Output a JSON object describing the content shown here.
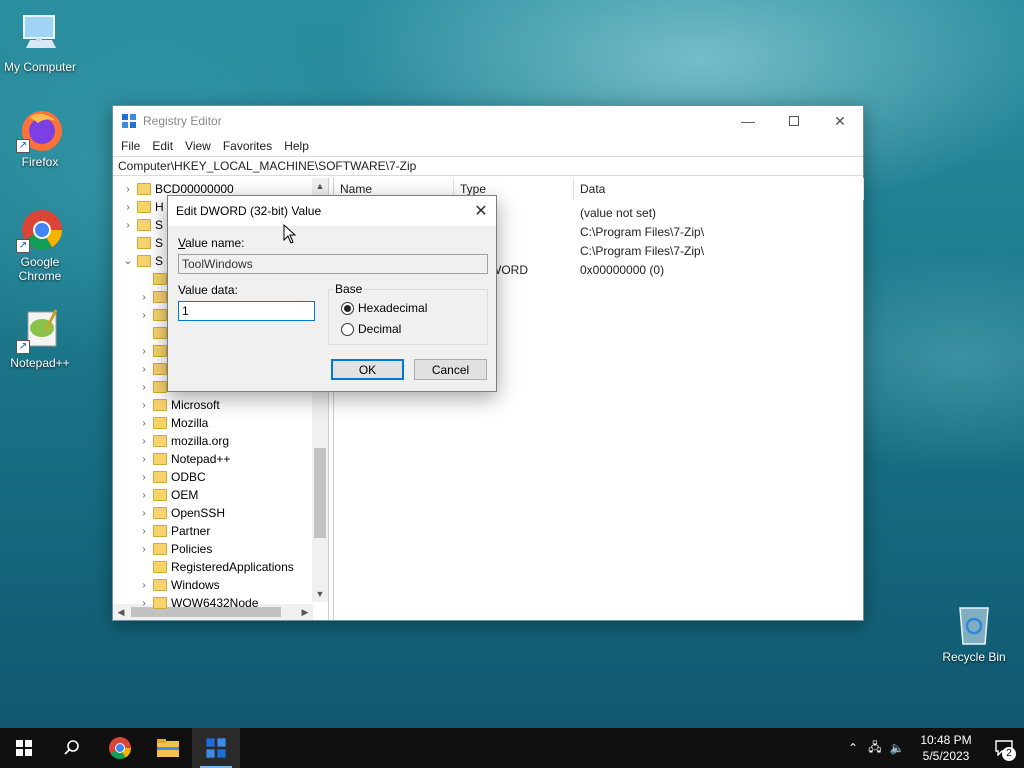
{
  "desktop": {
    "icons": [
      {
        "label": "My Computer",
        "icon": "computer-icon"
      },
      {
        "label": "Firefox",
        "icon": "firefox-icon"
      },
      {
        "label": "Google Chrome",
        "icon": "chrome-icon"
      },
      {
        "label": "Notepad++",
        "icon": "notepadpp-icon"
      },
      {
        "label": "Recycle Bin",
        "icon": "recycle-bin-icon"
      }
    ]
  },
  "regedit": {
    "title": "Registry Editor",
    "menu": [
      "File",
      "Edit",
      "View",
      "Favorites",
      "Help"
    ],
    "address": "Computer\\HKEY_LOCAL_MACHINE\\SOFTWARE\\7-Zip",
    "tree": [
      {
        "label": "BCD00000000",
        "chev": "›"
      },
      {
        "label": "H",
        "chev": "›"
      },
      {
        "label": "S",
        "chev": "›"
      },
      {
        "label": "S",
        "chev": ""
      },
      {
        "label": "S",
        "chev": "⌄"
      },
      {
        "label": "",
        "chev": ""
      },
      {
        "label": "",
        "chev": "›"
      },
      {
        "label": "",
        "chev": "›"
      },
      {
        "label": "",
        "chev": ""
      },
      {
        "label": "",
        "chev": "›"
      },
      {
        "label": "",
        "chev": "›"
      },
      {
        "label": "",
        "chev": "›"
      },
      {
        "label": "Microsoft",
        "chev": "›"
      },
      {
        "label": "Mozilla",
        "chev": "›"
      },
      {
        "label": "mozilla.org",
        "chev": "›"
      },
      {
        "label": "Notepad++",
        "chev": "›"
      },
      {
        "label": "ODBC",
        "chev": "›"
      },
      {
        "label": "OEM",
        "chev": "›"
      },
      {
        "label": "OpenSSH",
        "chev": "›"
      },
      {
        "label": "Partner",
        "chev": "›"
      },
      {
        "label": "Policies",
        "chev": "›"
      },
      {
        "label": "RegisteredApplications",
        "chev": ""
      },
      {
        "label": "Windows",
        "chev": "›"
      },
      {
        "label": "WOW6432Node",
        "chev": "›"
      }
    ],
    "columns": {
      "name": "Name",
      "type": "Type",
      "data": "Data"
    },
    "values": [
      {
        "type_tail": "Z",
        "data": "(value not set)"
      },
      {
        "type_tail": "Z",
        "data": "C:\\Program Files\\7-Zip\\"
      },
      {
        "type_tail": "Z",
        "data": "C:\\Program Files\\7-Zip\\"
      },
      {
        "type_tail": "WORD",
        "data": "0x00000000 (0)"
      }
    ]
  },
  "dialog": {
    "title": "Edit DWORD (32-bit) Value",
    "value_name_label": "Value name:",
    "value_name": "ToolWindows",
    "value_data_label": "Value data:",
    "value_data": "1",
    "base_label": "Base",
    "hex_label": "Hexadecimal",
    "dec_label": "Decimal",
    "ok_label": "OK",
    "cancel_label": "Cancel"
  },
  "taskbar": {
    "time": "10:48 PM",
    "date": "5/5/2023",
    "notifications": "2"
  }
}
